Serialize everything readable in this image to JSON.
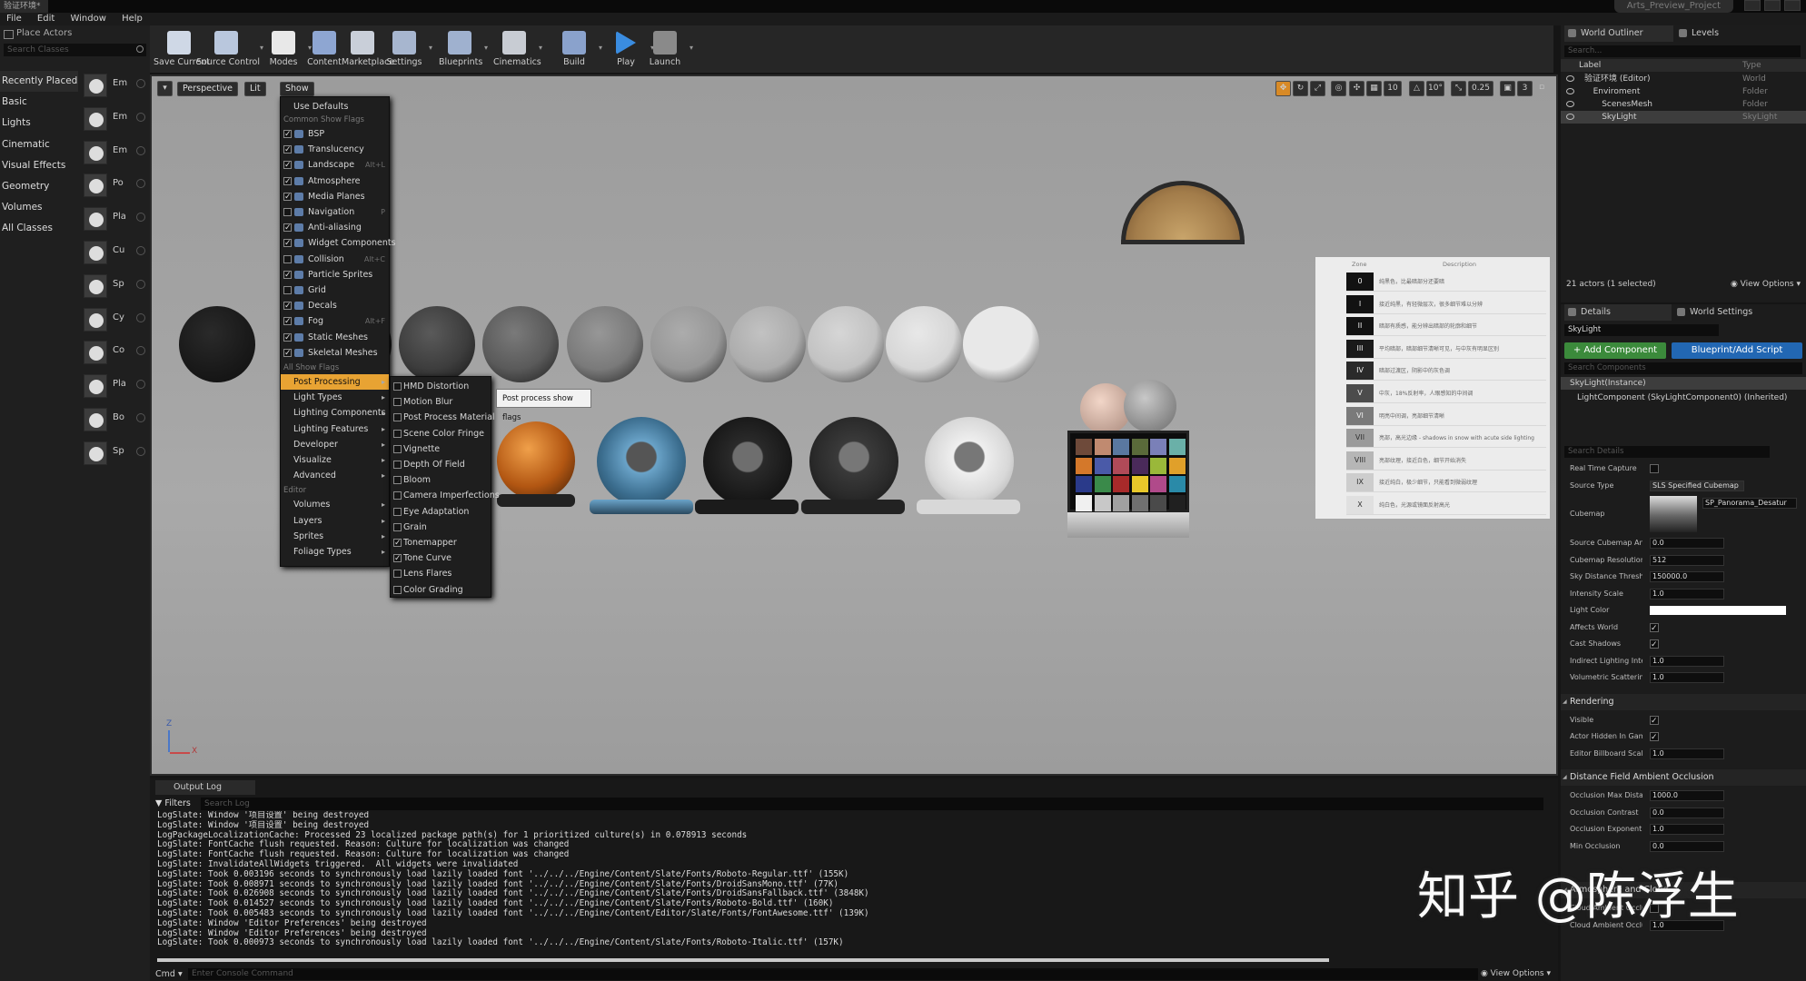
{
  "window": {
    "tab_title": "验证环境*",
    "project": "Arts_Preview_Project"
  },
  "menu": [
    "File",
    "Edit",
    "Window",
    "Help"
  ],
  "place_actors": {
    "title": "Place Actors",
    "search_placeholder": "Search Classes",
    "categories": [
      "Recently Placed",
      "Basic",
      "Lights",
      "Cinematic",
      "Visual Effects",
      "Geometry",
      "Volumes",
      "All Classes"
    ],
    "items": [
      "Em",
      "Em",
      "Em",
      "Po",
      "Pla",
      "Cu",
      "Sp",
      "Cy",
      "Co",
      "Pla",
      "Bo",
      "Sp"
    ]
  },
  "toolbar": [
    {
      "label": "Save Current",
      "icon": "save-icon"
    },
    {
      "label": "Source Control",
      "icon": "source-control-icon"
    },
    {
      "label": "Modes",
      "icon": "modes-icon"
    },
    {
      "label": "Content",
      "icon": "content-icon"
    },
    {
      "label": "Marketplace",
      "icon": "marketplace-icon"
    },
    {
      "label": "Settings",
      "icon": "settings-icon"
    },
    {
      "label": "Blueprints",
      "icon": "blueprints-icon"
    },
    {
      "label": "Cinematics",
      "icon": "cinematics-icon"
    },
    {
      "label": "Build",
      "icon": "build-icon"
    },
    {
      "label": "Play",
      "icon": "play-icon"
    },
    {
      "label": "Launch",
      "icon": "launch-icon"
    }
  ],
  "viewport": {
    "perspective": "Perspective",
    "lit": "Lit",
    "show": "Show",
    "snap_values": [
      "10",
      "10°",
      "0.25",
      "3"
    ],
    "axis_labels": {
      "z": "Z",
      "x": "X"
    }
  },
  "show_menu": {
    "use_defaults": "Use Defaults",
    "common_header": "Common Show Flags",
    "common": [
      {
        "label": "BSP",
        "checked": true,
        "shortcut": ""
      },
      {
        "label": "Translucency",
        "checked": true,
        "shortcut": ""
      },
      {
        "label": "Landscape",
        "checked": true,
        "shortcut": "Alt+L"
      },
      {
        "label": "Atmosphere",
        "checked": true,
        "shortcut": ""
      },
      {
        "label": "Media Planes",
        "checked": true,
        "shortcut": ""
      },
      {
        "label": "Navigation",
        "checked": false,
        "shortcut": "P"
      },
      {
        "label": "Anti-aliasing",
        "checked": true,
        "shortcut": ""
      },
      {
        "label": "Widget Components",
        "checked": true,
        "shortcut": ""
      },
      {
        "label": "Collision",
        "checked": false,
        "shortcut": "Alt+C"
      },
      {
        "label": "Particle Sprites",
        "checked": true,
        "shortcut": ""
      },
      {
        "label": "Grid",
        "checked": false,
        "shortcut": ""
      },
      {
        "label": "Decals",
        "checked": true,
        "shortcut": ""
      },
      {
        "label": "Fog",
        "checked": true,
        "shortcut": "Alt+F"
      },
      {
        "label": "Static Meshes",
        "checked": true,
        "shortcut": ""
      },
      {
        "label": "Skeletal Meshes",
        "checked": true,
        "shortcut": ""
      }
    ],
    "all_header": "All Show Flags",
    "all": [
      "Post Processing",
      "Light Types",
      "Lighting Components",
      "Lighting Features",
      "Developer",
      "Visualize",
      "Advanced"
    ],
    "editor_header": "Editor",
    "editor": [
      "Volumes",
      "Layers",
      "Sprites",
      "Foliage Types"
    ]
  },
  "post_submenu": [
    {
      "label": "HMD Distortion",
      "checked": false
    },
    {
      "label": "Motion Blur",
      "checked": false
    },
    {
      "label": "Post Process Material",
      "checked": false
    },
    {
      "label": "Scene Color Fringe",
      "checked": false
    },
    {
      "label": "Vignette",
      "checked": false
    },
    {
      "label": "Depth Of Field",
      "checked": false
    },
    {
      "label": "Bloom",
      "checked": false
    },
    {
      "label": "Camera Imperfections",
      "checked": false
    },
    {
      "label": "Eye Adaptation",
      "checked": false
    },
    {
      "label": "Grain",
      "checked": false
    },
    {
      "label": "Tonemapper",
      "checked": true
    },
    {
      "label": "Tone Curve",
      "checked": true
    },
    {
      "label": "Lens Flares",
      "checked": false
    },
    {
      "label": "Color Grading",
      "checked": false
    }
  ],
  "tooltip": "Post process show flags",
  "zone_chart": {
    "headers": [
      "Zone",
      "Description"
    ],
    "zones": [
      "0",
      "I",
      "II",
      "III",
      "IV",
      "V",
      "VI",
      "VII",
      "VIII",
      "IX",
      "X"
    ],
    "shade_colors": [
      "#121212",
      "#121212",
      "#121212",
      "#1a1a1a",
      "#2a2a2a",
      "#4c4c4c",
      "#7a7a7a",
      "#9a9a9a",
      "#b6b6b6",
      "#cdcdcd",
      "#e0e0e0"
    ],
    "descriptions": [
      "纯黑色，比最暗部分还要暗",
      "接近纯黑，有轻微层次，很多细节难以分辨",
      "暗部有质感，能分辨出暗部的轮廓和细节",
      "平均暗部，暗部细节清晰可见，与中灰有明显区别",
      "暗部过渡区，阴影中的灰色调",
      "中灰，18%反射率，人眼感知的中间调",
      "明亮中间调，亮部细节清晰",
      "亮部，高光边缘 - shadows in snow with acute side lighting",
      "亮部纹理，接近白色，细节开始消失",
      "接近纯白，极少细节，只能看到微弱纹理",
      "纯白色，光源或镜面反射高光"
    ]
  },
  "output_log": {
    "tab": "Output Log",
    "filters": "Filters",
    "search_placeholder": "Search Log",
    "lines": [
      "LogSlate: Window '项目设置' being destroyed",
      "LogSlate: Window '项目设置' being destroyed",
      "LogPackageLocalizationCache: Processed 23 localized package path(s) for 1 prioritized culture(s) in 0.078913 seconds",
      "LogSlate: FontCache flush requested. Reason: Culture for localization was changed",
      "LogSlate: FontCache flush requested. Reason: Culture for localization was changed",
      "LogSlate: InvalidateAllWidgets triggered.  All widgets were invalidated",
      "LogSlate: Took 0.003196 seconds to synchronously load lazily loaded font '../../../Engine/Content/Slate/Fonts/Roboto-Regular.ttf' (155K)",
      "LogSlate: Took 0.008971 seconds to synchronously load lazily loaded font '../../../Engine/Content/Slate/Fonts/DroidSansMono.ttf' (77K)",
      "LogSlate: Took 0.026908 seconds to synchronously load lazily loaded font '../../../Engine/Content/Slate/Fonts/DroidSansFallback.ttf' (3848K)",
      "LogSlate: Took 0.014527 seconds to synchronously load lazily loaded font '../../../Engine/Content/Slate/Fonts/Roboto-Bold.ttf' (160K)",
      "LogSlate: Took 0.005483 seconds to synchronously load lazily loaded font '../../../Engine/Content/Editor/Slate/Fonts/FontAwesome.ttf' (139K)",
      "LogSlate: Window 'Editor Preferences' being destroyed",
      "LogSlate: Window 'Editor Preferences' being destroyed",
      "LogSlate: Took 0.000973 seconds to synchronously load lazily loaded font '../../../Engine/Content/Slate/Fonts/Roboto-Italic.ttf' (157K)"
    ],
    "cmd_label": "Cmd",
    "cmd_placeholder": "Enter Console Command",
    "view_options": "View Options"
  },
  "outliner": {
    "tabs": [
      "World Outliner",
      "Levels"
    ],
    "search_placeholder": "Search...",
    "col_label": "Label",
    "col_type": "Type",
    "rows": [
      {
        "label": "验证环境 (Editor)",
        "type": "World"
      },
      {
        "label": "Enviroment",
        "type": "Folder"
      },
      {
        "label": "ScenesMesh",
        "type": "Folder"
      },
      {
        "label": "SkyLight",
        "type": "SkyLight"
      }
    ],
    "footer": "21 actors (1 selected)",
    "view_options": "View Options"
  },
  "details": {
    "tabs": [
      "Details",
      "World Settings"
    ],
    "name": "SkyLight",
    "add_component": "+ Add Component",
    "blueprint": "Blueprint/Add Script",
    "search_components": "Search Components",
    "components": [
      "SkyLight(Instance)",
      "LightComponent (SkyLightComponent0) (Inherited)"
    ],
    "search_details": "Search Details",
    "props": [
      {
        "label": "Real Time Capture",
        "kind": "cb",
        "value": "",
        "checked": false
      },
      {
        "label": "Source Type",
        "kind": "val",
        "value": "SLS Specified Cubemap"
      },
      {
        "label": "Cubemap",
        "kind": "cubemap",
        "value": "SP_Panorama_Desatur"
      },
      {
        "label": "Source Cubemap Angle",
        "kind": "val",
        "value": "0.0"
      },
      {
        "label": "Cubemap Resolution",
        "kind": "val",
        "value": "512"
      },
      {
        "label": "Sky Distance Threshold",
        "kind": "val",
        "value": "150000.0"
      },
      {
        "label": "Intensity Scale",
        "kind": "val",
        "value": "1.0"
      },
      {
        "label": "Light Color",
        "kind": "color",
        "value": ""
      },
      {
        "label": "Affects World",
        "kind": "cb",
        "checked": true
      },
      {
        "label": "Cast Shadows",
        "kind": "cb",
        "checked": true
      },
      {
        "label": "Indirect Lighting Intensity",
        "kind": "val",
        "value": "1.0"
      },
      {
        "label": "Volumetric Scattering Intensity",
        "kind": "val",
        "value": "1.0"
      }
    ],
    "rendering_header": "Rendering",
    "rendering": [
      {
        "label": "Visible",
        "kind": "cb",
        "checked": true
      },
      {
        "label": "Actor Hidden In Game",
        "kind": "cb",
        "checked": true
      },
      {
        "label": "Editor Billboard Scale",
        "kind": "val",
        "value": "1.0"
      }
    ],
    "dfao_header": "Distance Field Ambient Occlusion",
    "dfao": [
      {
        "label": "Occlusion Max Distance",
        "kind": "val",
        "value": "1000.0"
      },
      {
        "label": "Occlusion Contrast",
        "kind": "val",
        "value": "0.0"
      },
      {
        "label": "Occlusion Exponent",
        "kind": "val",
        "value": "1.0"
      },
      {
        "label": "Min Occlusion",
        "kind": "val",
        "value": "0.0"
      }
    ],
    "atmo_header": "Atmosphere and Cloud",
    "atmo": [
      {
        "label": "Cloud Ambient Occlusion",
        "kind": "cb",
        "checked": false
      },
      {
        "label": "Cloud Ambient Occlusion Strength",
        "kind": "val",
        "value": "1.0"
      }
    ]
  },
  "watermark": "知乎 @陈浮生",
  "colors": {
    "accent": "#e8a333",
    "add_component": "#3b8a3b",
    "blueprint": "#2267b3"
  }
}
